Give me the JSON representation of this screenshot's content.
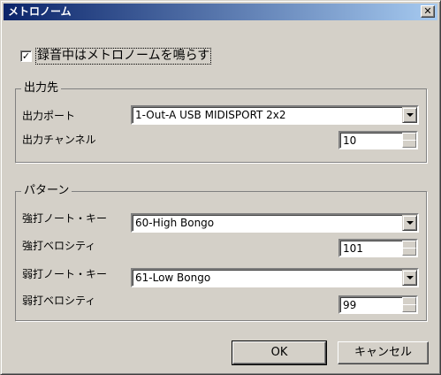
{
  "window": {
    "title": "メトロノーム",
    "close_glyph": "✕"
  },
  "metronome_enable": {
    "label": "録音中はメトロノームを鳴らす",
    "checked": true,
    "check_glyph": "✓"
  },
  "output": {
    "group_title": "出力先",
    "port_label": "出力ポート",
    "port_value": "1-Out-A USB MIDISPORT 2x2",
    "channel_label": "出力チャンネル",
    "channel_value": "10"
  },
  "pattern": {
    "group_title": "パターン",
    "strong_note_label": "強打ノート・キー",
    "strong_note_value": "60-High Bongo",
    "strong_velocity_label": "強打ベロシティ",
    "strong_velocity_value": "101",
    "weak_note_label": "弱打ノート・キー",
    "weak_note_value": "61-Low Bongo",
    "weak_velocity_label": "弱打ベロシティ",
    "weak_velocity_value": "99"
  },
  "buttons": {
    "ok": "OK",
    "cancel": "キャンセル"
  }
}
